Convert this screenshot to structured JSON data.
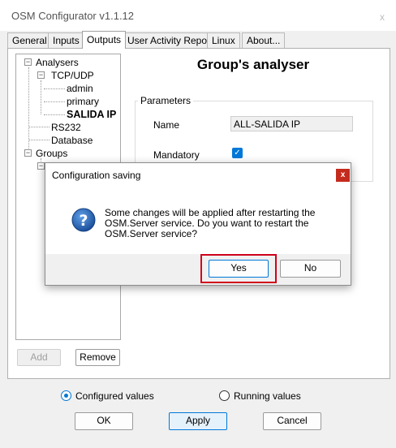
{
  "window": {
    "title": "OSM Configurator v1.1.12",
    "close_glyph": "x"
  },
  "tabs": [
    {
      "label": "General"
    },
    {
      "label": "Inputs"
    },
    {
      "label": "Outputs",
      "active": true
    },
    {
      "label": "User Activity Report"
    },
    {
      "label": "Linux"
    },
    {
      "label": "About..."
    }
  ],
  "tree": {
    "analysers": "Analysers",
    "tcp_udp": "TCP/UDP",
    "admin": "admin",
    "primary": "primary",
    "salida_ip": "SALIDA IP",
    "rs232": "RS232",
    "database": "Database",
    "groups": "Groups"
  },
  "buttons": {
    "add": "Add",
    "remove": "Remove",
    "ok": "OK",
    "apply": "Apply",
    "cancel": "Cancel"
  },
  "detail": {
    "title": "Group's analyser",
    "section": "Parameters",
    "name_label": "Name",
    "name_value": "ALL-SALIDA IP",
    "mandatory_label": "Mandatory",
    "mandatory_checked": true
  },
  "radios": {
    "configured": "Configured values",
    "running": "Running values",
    "selected": "configured"
  },
  "dialog": {
    "title": "Configuration saving",
    "close_glyph": "x",
    "message": "Some changes will be applied after restarting the OSM.Server service. Do you want to restart the OSM.Server service?",
    "yes": "Yes",
    "no": "No",
    "icon": "question-icon"
  },
  "colors": {
    "accent": "#0078d7",
    "highlight": "#d0021b",
    "close_red": "#c42b1c"
  }
}
